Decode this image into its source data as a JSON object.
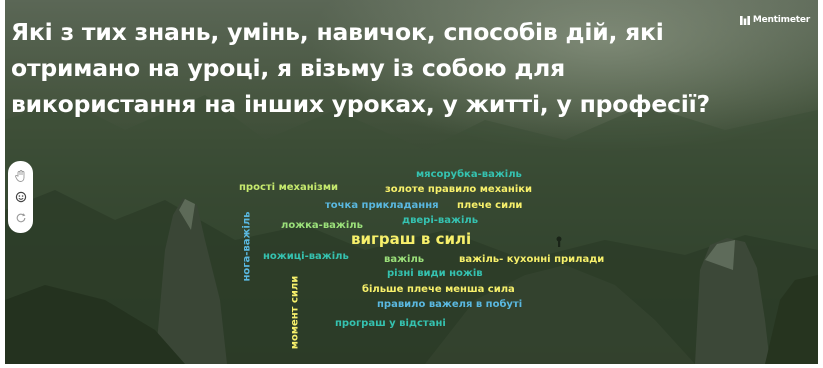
{
  "question": "Які з тих знань, умінь, навичок, способів дій, які отримано на уроці, я візьму із собою для використання на інших уроках, у житті, у професії?",
  "logo": {
    "text": "Mentimeter",
    "icon": "mentimeter-logo-icon"
  },
  "controls": [
    {
      "name": "hand-icon"
    },
    {
      "name": "reactions-icon"
    },
    {
      "name": "refresh-icon"
    }
  ],
  "colors": {
    "yellow": "#f7f06b",
    "green": "#9be07a",
    "teal": "#35c2b0",
    "blue": "#5ab8e0",
    "lime": "#c6ea6e"
  },
  "word_cloud": [
    "мясорубка-важіль",
    "прості механізми",
    "золоте правило механіки",
    "точка прикладання",
    "плече сили",
    "двері-важіль",
    "ложка-важіль",
    "нога-важіль",
    "виграш в силі",
    "ножиці-важіль",
    "важіль",
    "важіль- кухонні прилади",
    "різні види ножів",
    "більше плече менша сила",
    "момент сили",
    "правило важеля в побуті",
    "програш у відстані"
  ]
}
